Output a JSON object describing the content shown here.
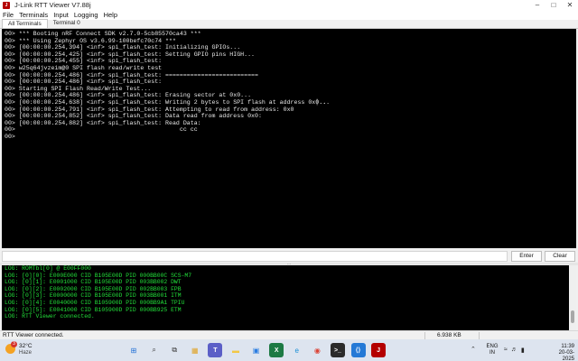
{
  "window": {
    "title": "J-Link RTT Viewer V7.88j",
    "app_icon_text": "J"
  },
  "menu": {
    "items": [
      "File",
      "Terminals",
      "Input",
      "Logging",
      "Help"
    ]
  },
  "tabs": [
    {
      "label": "All Terminals",
      "active": true
    },
    {
      "label": "Terminal 0",
      "active": false
    }
  ],
  "terminal": {
    "lines": [
      "00> *** Booting nRF Connect SDK v2.7.0-5cb85570ca43 ***",
      "00> *** Using Zephyr OS v3.6.99-100befc70c74 ***",
      "00> [00:00:00.254,394] <inf> spi_flash_test: Initializing GPIOs...",
      "00> [00:00:00.254,425] <inf> spi_flash_test: Setting GPIO pins HIGH...",
      "00> [00:00:00.254,455] <inf> spi_flash_test:",
      "00> w25q64jvzeim@0 SPI flash read/write test",
      "00> [00:00:00.254,486] <inf> spi_flash_test: ==========================",
      "00> [00:00:00.254,486] <inf> spi_flash_test:",
      "00> Starting SPI Flash Read/Write Test...",
      "00> [00:00:00.254,486] <inf> spi_flash_test: Erasing sector at 0x0...",
      "00> [00:00:00.254,638] <inf> spi_flash_test: Writing 2 bytes to SPI flash at address 0x0...",
      "00> [00:00:00.254,791] <inf> spi_flash_test: Attempting to read from address: 0x0",
      "00> [00:00:00.254,852] <inf> spi_flash_test: Data read from address 0x0:",
      "00> [00:00:00.254,882] <inf> spi_flash_test: Read Data:",
      "00>                                              cc cc",
      "00>"
    ],
    "cursor_text": "|.."
  },
  "input": {
    "value": "",
    "enter_label": "Enter",
    "clear_label": "Clear"
  },
  "log": {
    "lines": [
      "LOG: ROMTbl[0] @ E00FF000",
      "LOG: [0][0]: E000E000 CID B105E00D PID 000BB00C SCS-M7",
      "LOG: [0][1]: E0001000 CID B105E00D PID 003BB002 DWT",
      "LOG: [0][2]: E0002000 CID B105E00D PID 002BB003 FPB",
      "LOG: [0][3]: E0000000 CID B105E00D PID 003BB001 ITM",
      "LOG: [0][4]: E0040000 CID B105900D PID 000BB9A1 TPIU",
      "LOG: [0][5]: E0041000 CID B105900D PID 000BB925 ETM",
      "LOG: RTT Viewer connected."
    ]
  },
  "status": {
    "connection": "RTT Viewer connected.",
    "data_size": "6.938 KB"
  },
  "taskbar": {
    "weather_temp": "32°C",
    "weather_desc": "Haze",
    "weather_badge": "3",
    "lang_line1": "ENG",
    "lang_line2": "IN",
    "time": "11:39",
    "date": "20-03-2025",
    "apps": [
      {
        "name": "start-icon",
        "color": "#1f6fd6"
      },
      {
        "name": "search-icon",
        "color": "#3a3a3a"
      },
      {
        "name": "task-view-icon",
        "color": "#3a3a3a"
      },
      {
        "name": "widgets-icon",
        "color": "#e0a52c"
      },
      {
        "name": "teams-icon",
        "color": "#5b5fc7"
      },
      {
        "name": "explorer-icon",
        "color": "#f2c744"
      },
      {
        "name": "store-icon",
        "color": "#2a7de1"
      },
      {
        "name": "excel-icon",
        "color": "#1d7a44"
      },
      {
        "name": "edge-icon",
        "color": "#1a8fd6"
      },
      {
        "name": "chrome-icon",
        "color": "#db4437"
      },
      {
        "name": "terminal-icon",
        "color": "#2b2b2b"
      },
      {
        "name": "vscode-icon",
        "color": "#2479d6"
      },
      {
        "name": "jlink-icon",
        "color": "#b40000"
      }
    ]
  }
}
